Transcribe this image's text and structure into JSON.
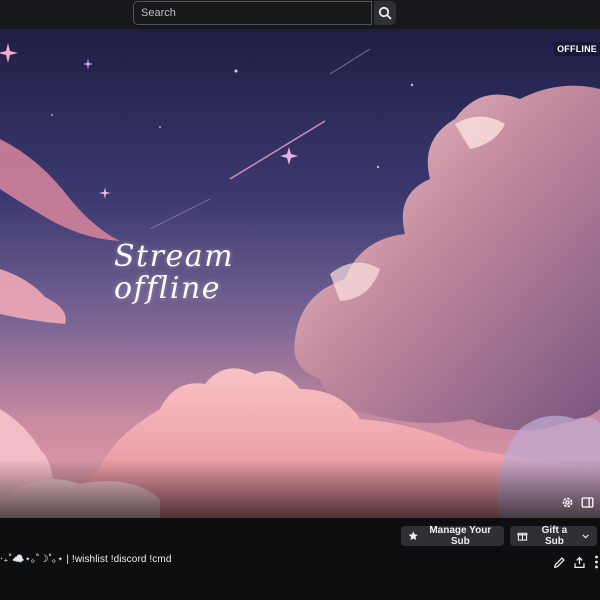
{
  "search": {
    "placeholder": "Search"
  },
  "player": {
    "status": "OFFLINE",
    "offline_line1": "Stream",
    "offline_line2": "offline"
  },
  "channel": {
    "manage_sub_label": "Manage Your Sub",
    "gift_sub_label": "Gift a Sub",
    "stream_title": "‧₊˚☁️⋆｡˚☽˚｡⋆ | !wishlist !discord !cmd"
  },
  "icons": {
    "search": "search-icon",
    "gear": "gear-icon",
    "theatre": "theatre-mode-icon",
    "star": "star-icon",
    "gift": "gift-icon",
    "chevron": "chevron-down-icon",
    "edit": "pencil-icon",
    "share": "share-icon",
    "more": "more-vertical-icon"
  },
  "colors": {
    "background": "#18181b",
    "infobar": "#0e0e10",
    "button": "#2f2f35",
    "sky_top": "#24224a",
    "cloud_pink": "#f0a6b4",
    "cloud_mauve": "#8a5a86"
  }
}
